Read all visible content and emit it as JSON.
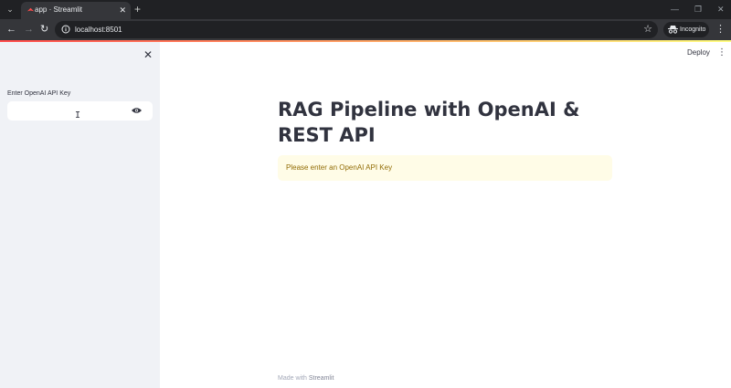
{
  "browser": {
    "tab": {
      "title": "app · Streamlit"
    },
    "new_tab_label": "+",
    "address": "localhost:8501",
    "profile_label": "Incognito"
  },
  "app": {
    "sidebar": {
      "api_key_label": "Enter OpenAI API Key",
      "api_key_value": ""
    },
    "header": {
      "deploy_label": "Deploy"
    },
    "title": "RAG Pipeline with OpenAI & REST API",
    "alert": {
      "text": "Please enter an OpenAI API Key",
      "kind": "warning"
    },
    "footer": {
      "prefix": "Made with",
      "brand": "Streamlit"
    }
  },
  "colors": {
    "accent": "#ff4b4b",
    "sidebar_bg": "#f0f2f6",
    "warning_bg": "#fffce7",
    "warning_text": "#926c05",
    "text": "#31333f"
  },
  "icons": [
    "tab-list-icon",
    "streamlit-favicon-icon",
    "close-tab-icon",
    "minimize-icon",
    "restore-icon",
    "close-window-icon",
    "back-icon",
    "forward-icon",
    "reload-icon",
    "site-info-icon",
    "bookmark-star-icon",
    "incognito-icon",
    "browser-menu-icon",
    "sidebar-close-icon",
    "eye-icon",
    "main-menu-icon"
  ]
}
